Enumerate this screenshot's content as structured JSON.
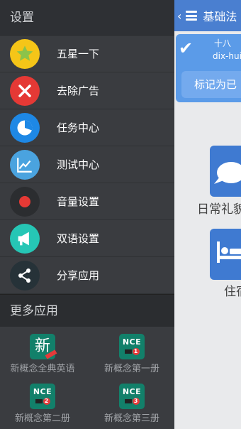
{
  "background_app": {
    "title": "基础法",
    "card": {
      "number": "十八",
      "pronunciation": "dix-huit",
      "mark_button": "标记为已"
    },
    "categories": [
      {
        "label": "日常礼貌",
        "icon": "speech-bubble-icon"
      },
      {
        "label": "住宿",
        "icon": "bed-icon"
      }
    ]
  },
  "drawer": {
    "header": "设置",
    "items": [
      {
        "label": "五星一下",
        "icon": "star-icon",
        "color": "#f5c518"
      },
      {
        "label": "去除广告",
        "icon": "close-icon",
        "color": "#e53935"
      },
      {
        "label": "任务中心",
        "icon": "pie-chart-icon",
        "color": "#1e88e5"
      },
      {
        "label": "测试中心",
        "icon": "line-chart-icon",
        "color": "#4aa3df"
      },
      {
        "label": "音量设置",
        "icon": "record-icon",
        "color": "#2b2d30"
      },
      {
        "label": "双语设置",
        "icon": "megaphone-icon",
        "color": "#26c6b5"
      },
      {
        "label": "分享应用",
        "icon": "share-icon",
        "color": "#263238"
      }
    ],
    "more_apps_header": "更多应用",
    "more_apps": [
      {
        "label": "新概念全典英语",
        "icon_text": "新"
      },
      {
        "label": "新概念第一册",
        "icon_text": "NCE",
        "badge": "1"
      },
      {
        "label": "新概念第二册",
        "icon_text": "NCE",
        "badge": "2"
      },
      {
        "label": "新概念第三册",
        "icon_text": "NCE",
        "badge": "3"
      }
    ]
  }
}
